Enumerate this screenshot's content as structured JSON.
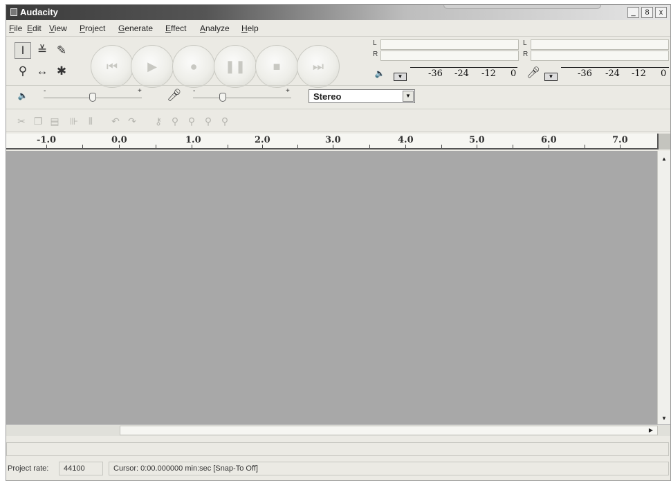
{
  "window": {
    "title": "Audacity",
    "controls": [
      "_",
      "8",
      "x"
    ]
  },
  "menu": [
    "File",
    "Edit",
    "View",
    "Project",
    "Generate",
    "Effect",
    "Analyze",
    "Help"
  ],
  "tools": [
    {
      "name": "selection-tool",
      "icon": "I-beam",
      "glyph": "I",
      "selected": true
    },
    {
      "name": "envelope-tool",
      "icon": "envelope",
      "glyph": "≚",
      "selected": false
    },
    {
      "name": "draw-tool",
      "icon": "pencil",
      "glyph": "✎",
      "selected": false
    },
    {
      "name": "zoom-tool",
      "icon": "magnifier",
      "glyph": "⚲",
      "selected": false
    },
    {
      "name": "timeshift-tool",
      "icon": "double-arrow",
      "glyph": "↔",
      "selected": false
    },
    {
      "name": "multi-tool",
      "icon": "asterisk",
      "glyph": "✱",
      "selected": false
    }
  ],
  "transport": [
    {
      "name": "skip-start",
      "icon": "skip-to-start",
      "glyph": "⏮"
    },
    {
      "name": "play",
      "icon": "play",
      "glyph": "▶"
    },
    {
      "name": "record",
      "icon": "record",
      "glyph": "●"
    },
    {
      "name": "pause",
      "icon": "pause",
      "glyph": "❚❚"
    },
    {
      "name": "stop",
      "icon": "stop",
      "glyph": "■"
    },
    {
      "name": "skip-end",
      "icon": "skip-to-end",
      "glyph": "⏭"
    }
  ],
  "meters": {
    "playback": {
      "left": "L",
      "right": "R",
      "scale": [
        "-36",
        "-24",
        "-12",
        "0"
      ]
    },
    "record": {
      "left": "L",
      "right": "R",
      "scale": [
        "-36",
        "-24",
        "-12",
        "0"
      ]
    }
  },
  "mixer": {
    "output_level": 0.5,
    "input_level": 0.3,
    "minus": "-",
    "plus": "+",
    "channel": "Stereo"
  },
  "edit_tools": [
    "cut",
    "copy",
    "paste",
    "trim",
    "silence",
    "undo",
    "redo",
    "sync-lock",
    "zoom-in",
    "zoom-out",
    "fit-selection",
    "fit-project"
  ],
  "ruler": [
    "-1.0",
    "0.0",
    "1.0",
    "2.0",
    "3.0",
    "4.0",
    "5.0",
    "6.0",
    "7.0"
  ],
  "status": {
    "project_rate_label": "Project rate:",
    "project_rate": "44100",
    "cursor_text": "Cursor: 0:00.000000 min:sec   [Snap-To Off]"
  },
  "colors": {
    "track_area": "#a8a8a8",
    "window_bg": "#ebeae4"
  }
}
